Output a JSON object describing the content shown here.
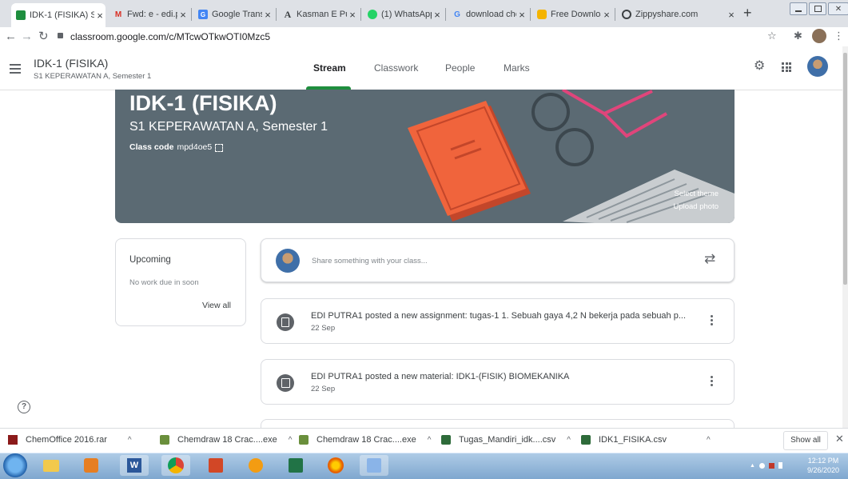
{
  "browser": {
    "tabs": [
      {
        "title": "IDK-1 (FISIKA) S",
        "active": true,
        "icon": "classroom-icon",
        "color": "#1e8e3e"
      },
      {
        "title": "Fwd: e - edi.put",
        "active": false,
        "icon": "gmail-icon",
        "color": "#d93025"
      },
      {
        "title": "Google Transla",
        "active": false,
        "icon": "translate-icon",
        "color": "#4285f4"
      },
      {
        "title": "Kasman E Putr:",
        "active": false,
        "icon": "academia-icon",
        "color": "#202124"
      },
      {
        "title": "(1) WhatsApp",
        "active": false,
        "icon": "whatsapp-icon",
        "color": "#25d366"
      },
      {
        "title": "download chen",
        "active": false,
        "icon": "google-icon",
        "color": "#4285f4"
      },
      {
        "title": "Free Download",
        "active": false,
        "icon": "download-site-icon",
        "color": "#f4b400"
      },
      {
        "title": "Zippyshare.com",
        "active": false,
        "icon": "zippyshare-icon",
        "color": "#3c4043"
      }
    ],
    "url": "classroom.google.com/c/MTcwOTkwOTI0Mzc5",
    "new_tab": "+"
  },
  "header": {
    "class_name": "IDK-1 (FISIKA)",
    "section": "S1 KEPERAWATAN A, Semester 1",
    "tabs": [
      "Stream",
      "Classwork",
      "People",
      "Marks"
    ],
    "active_tab": "Stream"
  },
  "banner": {
    "title": "IDK-1 (FISIKA)",
    "subtitle": "S1 KEPERAWATAN A, Semester 1",
    "class_code_label": "Class code",
    "class_code": "mpd4oe5",
    "select_theme": "Select theme",
    "upload_photo": "Upload photo"
  },
  "upcoming": {
    "title": "Upcoming",
    "status": "No work due in soon",
    "link": "View all"
  },
  "share": {
    "placeholder": "Share something with your class..."
  },
  "posts": [
    {
      "text": "EDI PUTRA1 posted a new assignment: tugas-1 1. Sebuah gaya 4,2 N bekerja pada sebuah p...",
      "date": "22 Sep",
      "icon": "assignment-icon"
    },
    {
      "text": "EDI PUTRA1 posted a new material: IDK1-(FISIK) BIOMEKANIKA",
      "date": "22 Sep",
      "icon": "material-icon"
    }
  ],
  "downloads": {
    "items": [
      {
        "name": "ChemOffice 2016.rar"
      },
      {
        "name": "Chemdraw 18 Crac....exe"
      },
      {
        "name": "Chemdraw 18 Crac....exe"
      },
      {
        "name": "Tugas_Mandiri_idk....csv"
      },
      {
        "name": "IDK1_FISIKA.csv"
      }
    ],
    "show_all": "Show all"
  },
  "taskbar": {
    "time": "12:12 PM",
    "date": "9/26/2020"
  },
  "colors": {
    "banner": "#5b6a73",
    "book": "#f0643c",
    "glasses": "#e0457b"
  }
}
